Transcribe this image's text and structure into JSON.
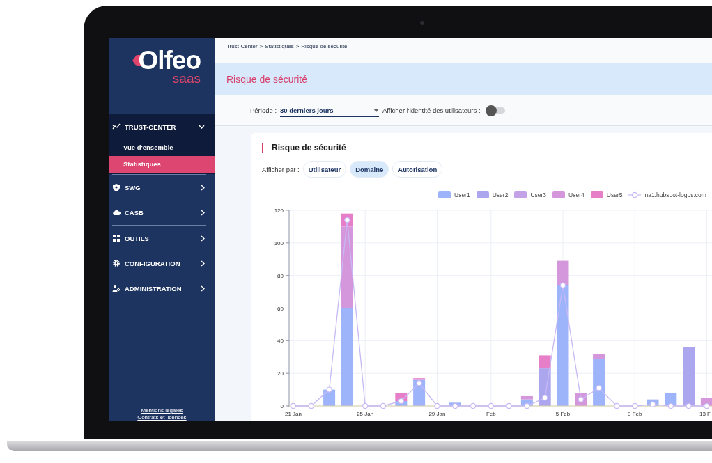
{
  "sidebar": {
    "logo": {
      "name": "Olfeo",
      "sub": "saas"
    },
    "groups": [
      [
        {
          "label": "TRUST-CENTER",
          "expanded": true,
          "children": [
            {
              "label": "Vue d'ensemble",
              "selected": false
            },
            {
              "label": "Statistiques",
              "selected": true
            }
          ]
        }
      ],
      [
        {
          "label": "SWG",
          "expanded": false
        },
        {
          "label": "CASB",
          "expanded": false
        }
      ],
      [
        {
          "label": "OUTILS",
          "expanded": false
        },
        {
          "label": "CONFIGURATION",
          "expanded": false
        },
        {
          "label": "ADMINISTRATION",
          "expanded": false
        }
      ]
    ],
    "footer_links": [
      "Mentions légales",
      "Contrats et licences"
    ]
  },
  "breadcrumb": [
    {
      "label": "Trust-Center",
      "link": true
    },
    {
      "label": ">",
      "link": false
    },
    {
      "label": "Statistiques",
      "link": true
    },
    {
      "label": ">",
      "link": false
    },
    {
      "label": "Risque de sécurité",
      "link": false
    }
  ],
  "page_title": "Risque de sécurité",
  "filters": {
    "period_label": "Période :",
    "period_value": "30 derniers jours",
    "identity_label": "Afficher l'identité des utilisateurs :",
    "identity_on": false
  },
  "card": {
    "title": "Risque de sécurité",
    "view_label": "Afficher par :",
    "view_tabs": [
      {
        "label": "Utilisateur",
        "selected": false
      },
      {
        "label": "Domaine",
        "selected": true
      },
      {
        "label": "Autorisation",
        "selected": false
      }
    ],
    "chart_data": {
      "type": "bar",
      "stacked": true,
      "grid": true,
      "categories": [
        "21 Jan",
        null,
        null,
        null,
        "25 Jan",
        null,
        null,
        null,
        "29 Jan",
        null,
        null,
        "Feb",
        null,
        null,
        null,
        "5 Feb",
        null,
        null,
        null,
        "9 Feb",
        null,
        null,
        null,
        "13 F"
      ],
      "ylim": [
        0,
        120
      ],
      "yticks": [
        0,
        20,
        40,
        60,
        80,
        100,
        120
      ],
      "series": [
        {
          "name": "User1",
          "type": "bar",
          "color": "#9db4fb",
          "values": [
            0,
            0,
            10,
            60,
            0,
            0,
            3,
            16,
            0,
            2,
            0,
            0,
            0,
            4,
            0,
            74,
            0,
            29,
            0,
            0,
            4,
            8,
            0,
            0
          ]
        },
        {
          "name": "User2",
          "type": "bar",
          "color": "#aba6ee",
          "values": [
            0,
            0,
            0,
            0,
            0,
            0,
            0,
            0,
            0,
            0,
            0,
            0,
            0,
            0,
            23,
            0,
            0,
            0,
            0,
            0,
            0,
            0,
            36,
            0
          ]
        },
        {
          "name": "User3",
          "type": "bar",
          "color": "#c3a2e8",
          "values": [
            0,
            0,
            0,
            0,
            0,
            0,
            0,
            0,
            0,
            0,
            0,
            0,
            0,
            0,
            0,
            0,
            0,
            0,
            0,
            0,
            0,
            0,
            0,
            0
          ]
        },
        {
          "name": "User4",
          "type": "bar",
          "color": "#d497db",
          "values": [
            0,
            null,
            0,
            50,
            0,
            0,
            0,
            0,
            0,
            0,
            0,
            0,
            0,
            2,
            0,
            15,
            8,
            3,
            0,
            0,
            0,
            0,
            0,
            5
          ]
        },
        {
          "name": "User5",
          "type": "bar",
          "color": "#e67fc8",
          "values": [
            0,
            0,
            0,
            8,
            0,
            0,
            5,
            1,
            0,
            0,
            0,
            0,
            0,
            0,
            8,
            0,
            0,
            0,
            0,
            0,
            0,
            0,
            0,
            0
          ]
        },
        {
          "name": "na1.hubspot-logos.com",
          "type": "line",
          "marker": "circle",
          "color": "#c7b9f6",
          "values": [
            0,
            0,
            10,
            114,
            0,
            0,
            3,
            14,
            0,
            0,
            0,
            0,
            0,
            0,
            5,
            74,
            4,
            11,
            0,
            0,
            1,
            0,
            0,
            0
          ]
        }
      ]
    }
  }
}
